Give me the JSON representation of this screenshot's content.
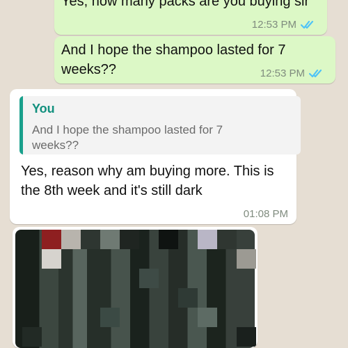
{
  "chat": {
    "messages": [
      {
        "direction": "outgoing",
        "text": "Yes, how many packs are you buying sir",
        "time": "12:53 PM",
        "status": "read"
      },
      {
        "direction": "outgoing",
        "text": "And I hope the shampoo lasted for 7 weeks??",
        "time": "12:53 PM",
        "status": "read"
      },
      {
        "direction": "incoming",
        "reply_to": {
          "author": "You",
          "text": "And I hope the shampoo lasted for 7 weeks??"
        },
        "text": "Yes, reason why am buying more. This is the 8th week and it's still dark",
        "time": "01:08 PM"
      },
      {
        "direction": "incoming",
        "type": "image",
        "content": "pixelated photo"
      }
    ]
  },
  "colors": {
    "outgoing_bubble": "#dcf8c6",
    "incoming_bubble": "#ffffff",
    "read_ticks": "#4fc3f7",
    "quote_accent": "#19a08c"
  },
  "icons": {
    "read_receipt": "double-check-icon"
  }
}
